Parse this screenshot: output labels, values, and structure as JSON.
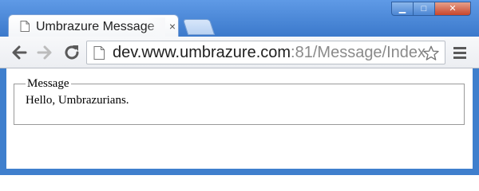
{
  "window": {
    "minimize_glyph": "▁",
    "maximize_glyph": "□",
    "close_glyph": "✕"
  },
  "tab": {
    "title": "Umbrazure Message",
    "close_glyph": "×"
  },
  "omnibox": {
    "url_host": "dev.www.umbrazure.com",
    "url_rest": ":81/Message/Index"
  },
  "page": {
    "legend": "Message",
    "message": "Hello, Umbrazurians."
  },
  "icons": {
    "back": "arrow-left-icon",
    "forward": "arrow-right-icon",
    "reload": "reload-icon",
    "page": "page-icon",
    "bookmark": "star-icon",
    "menu": "hamburger-menu-icon"
  },
  "colors": {
    "frame_blue": "#3f7fcd",
    "close_red": "#c8452c",
    "url_grey": "#8a8a8a"
  }
}
